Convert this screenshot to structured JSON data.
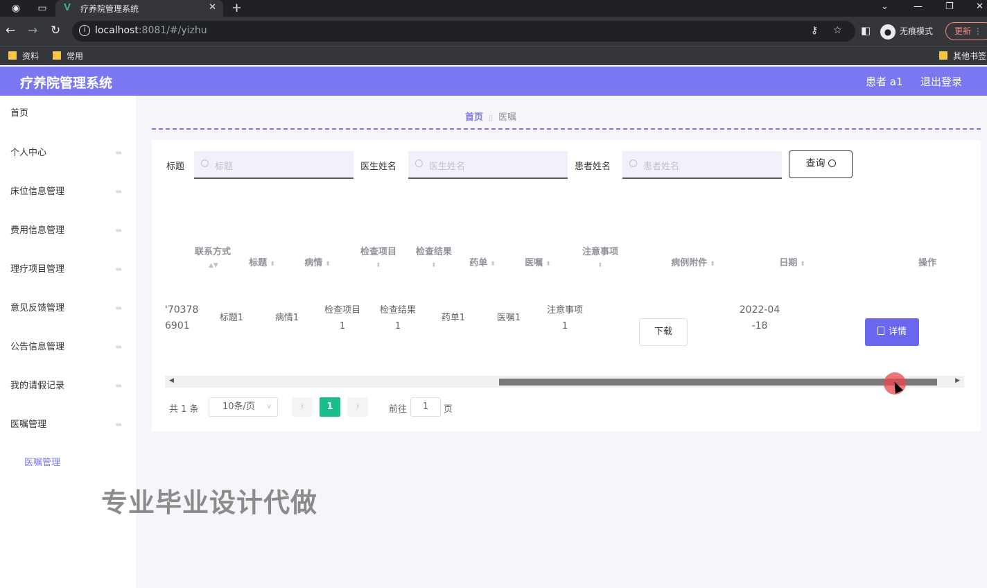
{
  "browser": {
    "tab_title": "疗养院管理系统",
    "tab_close": "✕",
    "new_tab": "+",
    "url_host": "localhost",
    "url_rest": ":8081/#/yizhu",
    "incognito_label": "无痕模式",
    "update_label": "更新",
    "bookmarks": [
      "资料",
      "常用"
    ],
    "other_bookmarks": "其他书签"
  },
  "header": {
    "app_title": "疗养院管理系统",
    "user_label": "患者 a1",
    "logout_label": "退出登录"
  },
  "sidebar": {
    "items": [
      {
        "label": "首页"
      },
      {
        "label": "个人中心"
      },
      {
        "label": "床位信息管理"
      },
      {
        "label": "费用信息管理"
      },
      {
        "label": "理疗项目管理"
      },
      {
        "label": "意见反馈管理"
      },
      {
        "label": "公告信息管理"
      },
      {
        "label": "我的请假记录"
      },
      {
        "label": "医嘱管理"
      }
    ],
    "sub_item": "医嘱管理"
  },
  "breadcrumb": {
    "home": "首页",
    "current": "医嘱"
  },
  "filters": {
    "title_label": "标题",
    "title_placeholder": "标题",
    "doctor_label": "医生姓名",
    "doctor_placeholder": "医生姓名",
    "patient_label": "患者姓名",
    "patient_placeholder": "患者姓名",
    "query_label": "查询"
  },
  "table": {
    "columns": [
      "联系方式",
      "标题",
      "病情",
      "检查项目",
      "检查结果",
      "药单",
      "医嘱",
      "注意事项",
      "病例附件",
      "日期",
      "操作"
    ],
    "row": {
      "contact_1": "'70378",
      "contact_2": "6901",
      "title": "标题1",
      "condition": "病情1",
      "exam_item_1": "检查项目",
      "exam_item_2": "1",
      "exam_result_1": "检查结果",
      "exam_result_2": "1",
      "prescription": "药单1",
      "advice": "医嘱1",
      "notes_1": "注意事项",
      "notes_2": "1",
      "download_label": "下载",
      "date_1": "2022-04",
      "date_2": "-18",
      "detail_label": "详情"
    }
  },
  "pagination": {
    "total": "共 1 条",
    "page_size": "10条/页",
    "current_page": "1",
    "goto_label": "前往",
    "goto_value": "1",
    "page_suffix": "页"
  },
  "watermark": "专业毕业设计代做",
  "colors": {
    "accent": "#7b77f0",
    "button": "#6a67ee",
    "page_active": "#19be8c"
  }
}
